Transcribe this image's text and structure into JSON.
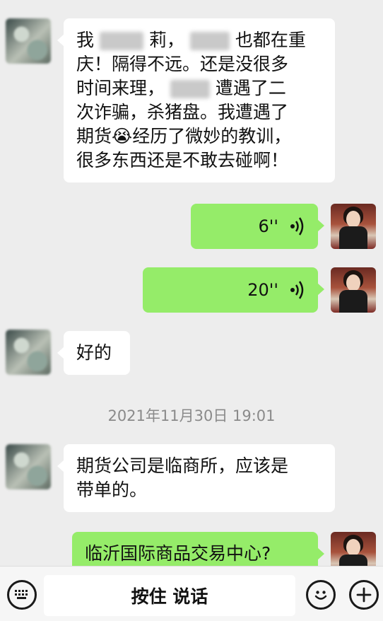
{
  "messages": {
    "m1": {
      "line1_a": "我",
      "line1_b": "莉，",
      "line1_c": "也都在重",
      "line2": "庆！隔得不远。还是没很多",
      "line3_a": "时间来理，",
      "line3_b": "遭遇了二",
      "line4": "次诈骗，杀猪盘。我遭遇了",
      "line5_a": "期货",
      "line5_emoji": "😭",
      "line5_b": "经历了微妙的教训，",
      "line6": "很多东西还是不敢去碰啊！"
    },
    "voice1_duration": "6''",
    "voice2_duration": "20''",
    "m2": "好的",
    "timestamp": "2021年11月30日 19:01",
    "m3_line1": "期货公司是临商所，应该是",
    "m3_line2": "带单的。",
    "m4": "临沂国际商品交易中心?"
  },
  "bottombar": {
    "hold_to_talk": "按住 说话",
    "keyboard_icon": "keyboard-icon",
    "emoji_icon": "emoji-icon",
    "plus_icon": "plus-icon"
  },
  "colors": {
    "background": "#ededed",
    "incoming_bubble": "#ffffff",
    "outgoing_bubble": "#95ec69",
    "timestamp_text": "#8a8a8a"
  }
}
